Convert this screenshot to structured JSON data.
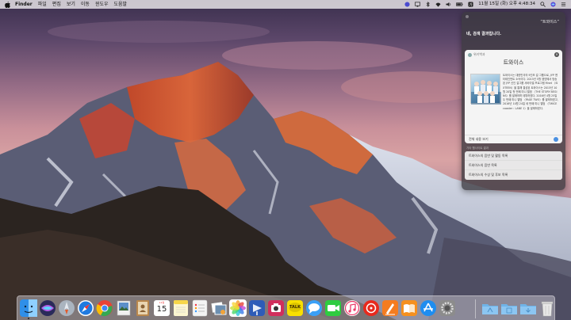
{
  "menubar": {
    "apple_icon": "apple-icon",
    "items": [
      "Finder",
      "파일",
      "편집",
      "보기",
      "이동",
      "윈도우",
      "도움말"
    ],
    "status_icons": [
      "siri-status-icon",
      "display-icon",
      "bluetooth-icon",
      "wifi-icon",
      "volume-icon",
      "battery-icon",
      "input-source-icon"
    ],
    "datetime": "11월 15일 (화) 오후 4:48:34",
    "search_icon": "spotlight-icon",
    "menu_icon": "notification-center-icon"
  },
  "siri": {
    "query": "“트와이스”",
    "answer": "네, 검색 결과입니다.",
    "card": {
      "source": "위키백과",
      "title": "트와이스",
      "description": "트와이스는 대한민국의 9인조 걸 그룹으로, JYP 엔터테인먼트 소속이다. 2015년 5월 엠넷에서 방송된 JYP 신인 걸그룹 서바이벌 프로그램 Mnet 〈SIXTEEN〉을 통해 결성된 트와이스는 2015년 10월 20일 첫 번째 미니 앨범 〈THE STORY BEGINS〉를 발매하며 데뷔하였다. 2016년 4월 25일 두 번째 미니 앨범 〈PAGE TWO〉를 발매하였고, 2016년 10월 24일 세 번째 미니 앨범 〈TWICEcoaster : LANE 1〉을 발매하였다.",
      "more_label": "전체 내용 보기"
    },
    "section_label": "기타 웹사이트 결과",
    "links": [
      "트와이스의 음반 및 활동 목록",
      "트와이스의 음반 목록",
      "트와이스의 수상 및 후보 목록"
    ]
  },
  "dock": {
    "apps": [
      {
        "name": "finder-icon",
        "color": "#2f8fe8"
      },
      {
        "name": "siri-icon",
        "color": "#6b3cc9"
      },
      {
        "name": "launchpad-icon",
        "color": "#9aa5b0"
      },
      {
        "name": "safari-icon",
        "color": "#1f7ae0"
      },
      {
        "name": "chrome-icon",
        "color": "#e84235"
      },
      {
        "name": "preview-icon",
        "color": "#5b8fc9"
      },
      {
        "name": "contacts-icon",
        "color": "#b8864b"
      },
      {
        "name": "calendar-icon",
        "color": "#ffffff"
      },
      {
        "name": "notes-icon",
        "color": "#f7e48a"
      },
      {
        "name": "reminders-icon",
        "color": "#f4f4f4"
      },
      {
        "name": "photo-browser-icon",
        "color": "#6d8fb0"
      },
      {
        "name": "photos-icon",
        "color": "#f2a33a"
      },
      {
        "name": "keynote-icon",
        "color": "#2e5cb8"
      },
      {
        "name": "photo-booth-icon",
        "color": "#d12f5c"
      },
      {
        "name": "kakaotalk-icon",
        "color": "#f9e000"
      },
      {
        "name": "messages-icon",
        "color": "#3aa0f7"
      },
      {
        "name": "facetime-icon",
        "color": "#2ecc40"
      },
      {
        "name": "itunes-icon",
        "color": "#ea3a6a"
      },
      {
        "name": "music-player-icon",
        "color": "#e8291c"
      },
      {
        "name": "pages-icon",
        "color": "#f57c1f"
      },
      {
        "name": "ibooks-icon",
        "color": "#f5901f"
      },
      {
        "name": "app-store-icon",
        "color": "#1e8df0"
      },
      {
        "name": "system-preferences-icon",
        "color": "#8c8c8c"
      }
    ],
    "calendar": {
      "month": "11월",
      "day": "15"
    },
    "kakaotalk_label": "TALK",
    "folders": [
      {
        "name": "applications-folder-icon",
        "color": "#6fb3e8"
      },
      {
        "name": "documents-folder-icon",
        "color": "#6fb3e8"
      },
      {
        "name": "downloads-folder-icon",
        "color": "#6fb3e8"
      },
      {
        "name": "trash-icon",
        "color": "#e8e8e8"
      }
    ]
  }
}
